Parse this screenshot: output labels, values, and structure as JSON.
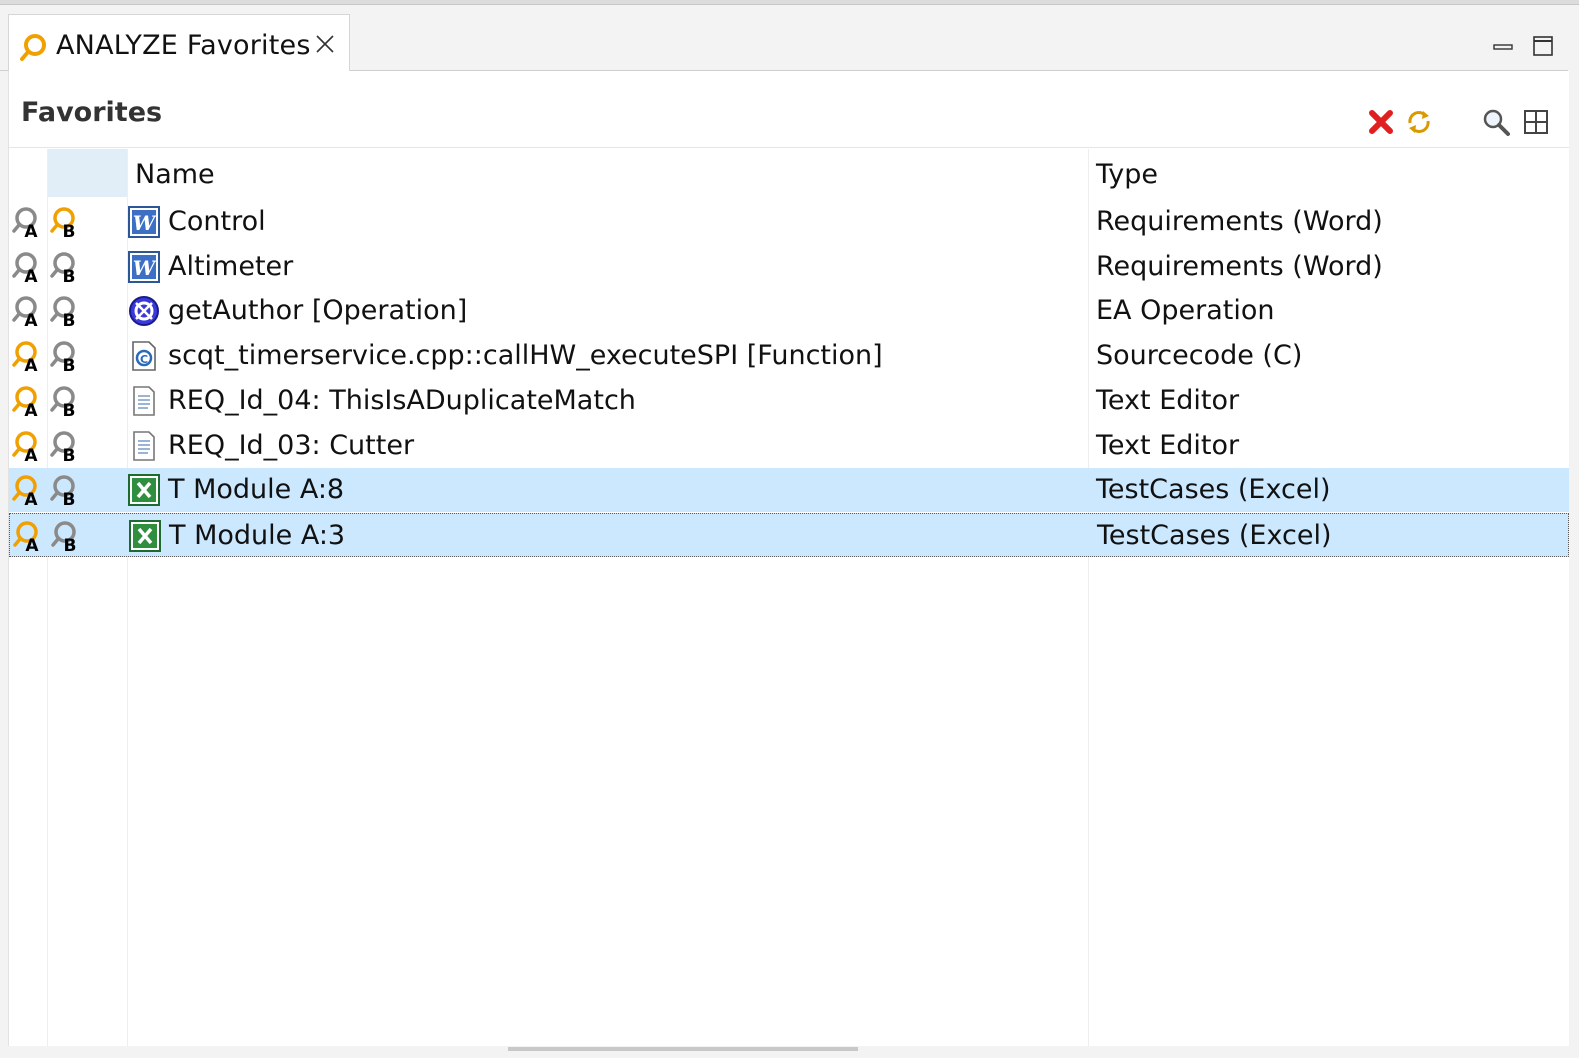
{
  "tab": {
    "title": "ANALYZE Favorites"
  },
  "view": {
    "title": "Favorites"
  },
  "columns": {
    "name": "Name",
    "type": "Type"
  },
  "rows": [
    {
      "name": "Control",
      "type": "Requirements (Word)",
      "icon": "word-doc-icon",
      "a": "grey",
      "b": "orange"
    },
    {
      "name": "Altimeter",
      "type": "Requirements (Word)",
      "icon": "word-doc-icon",
      "a": "grey",
      "b": "grey"
    },
    {
      "name": "getAuthor [Operation]",
      "type": "EA Operation",
      "icon": "ea-operation-icon",
      "a": "grey",
      "b": "grey"
    },
    {
      "name": "scqt_timerservice.cpp::callHW_executeSPI [Function]",
      "type": "Sourcecode (C)",
      "icon": "c-source-icon",
      "a": "orange",
      "b": "grey"
    },
    {
      "name": "REQ_Id_04: ThisIsADuplicateMatch",
      "type": "Text Editor",
      "icon": "text-file-icon",
      "a": "orange",
      "b": "grey"
    },
    {
      "name": "REQ_Id_03: Cutter",
      "type": "Text Editor",
      "icon": "text-file-icon",
      "a": "orange",
      "b": "grey"
    },
    {
      "name": "T Module A:8",
      "type": "TestCases (Excel)",
      "icon": "excel-doc-icon",
      "a": "orange",
      "b": "grey",
      "selected": true
    },
    {
      "name": "T Module A:3",
      "type": "TestCases (Excel)",
      "icon": "excel-doc-icon",
      "a": "orange",
      "b": "grey",
      "selected": true,
      "focused": true
    }
  ],
  "colors": {
    "orange": "#f0a000",
    "grey": "#8a8a8a",
    "selection": "#cce8ff",
    "delete": "#e02020"
  }
}
